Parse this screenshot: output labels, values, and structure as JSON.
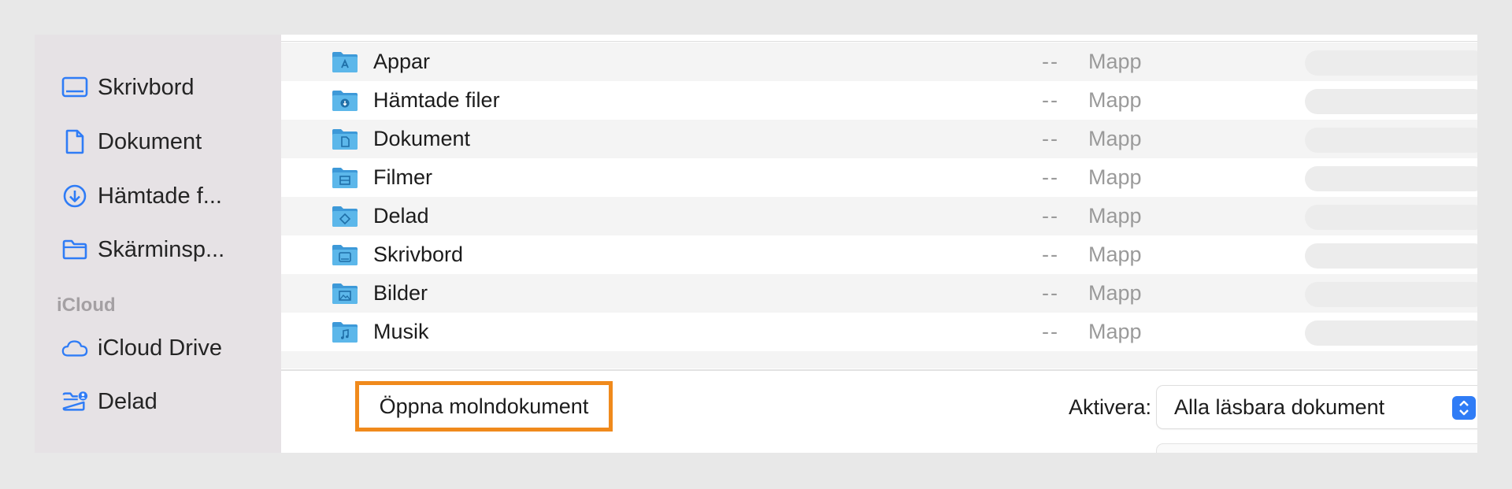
{
  "sidebar": {
    "items": [
      {
        "label": "Skrivbord",
        "icon": "desktop-icon"
      },
      {
        "label": "Dokument",
        "icon": "document-icon"
      },
      {
        "label": "Hämtade f...",
        "icon": "download-icon"
      },
      {
        "label": "Skärminsp...",
        "icon": "folder-icon"
      }
    ],
    "section_icloud": "iCloud",
    "icloud_items": [
      {
        "label": "iCloud Drive",
        "icon": "cloud-icon"
      },
      {
        "label": "Delad",
        "icon": "shared-folder-icon"
      }
    ]
  },
  "files": [
    {
      "name": "Appar",
      "size": "--",
      "kind": "Mapp",
      "icon": "applications-folder-icon"
    },
    {
      "name": "Hämtade filer",
      "size": "--",
      "kind": "Mapp",
      "icon": "downloads-folder-icon"
    },
    {
      "name": "Dokument",
      "size": "--",
      "kind": "Mapp",
      "icon": "documents-folder-icon"
    },
    {
      "name": "Filmer",
      "size": "--",
      "kind": "Mapp",
      "icon": "movies-folder-icon"
    },
    {
      "name": "Delad",
      "size": "--",
      "kind": "Mapp",
      "icon": "shared-folder-icon"
    },
    {
      "name": "Skrivbord",
      "size": "--",
      "kind": "Mapp",
      "icon": "desktop-folder-icon"
    },
    {
      "name": "Bilder",
      "size": "--",
      "kind": "Mapp",
      "icon": "pictures-folder-icon"
    },
    {
      "name": "Musik",
      "size": "--",
      "kind": "Mapp",
      "icon": "music-folder-icon"
    }
  ],
  "footer": {
    "cloud_button": "Öppna molndokument",
    "enable_label": "Aktivera:",
    "enable_value": "Alla läsbara dokument"
  },
  "colors": {
    "accent": "#2f7cf6",
    "highlight_border": "#f08a1c",
    "folder": "#5cb7ea"
  }
}
